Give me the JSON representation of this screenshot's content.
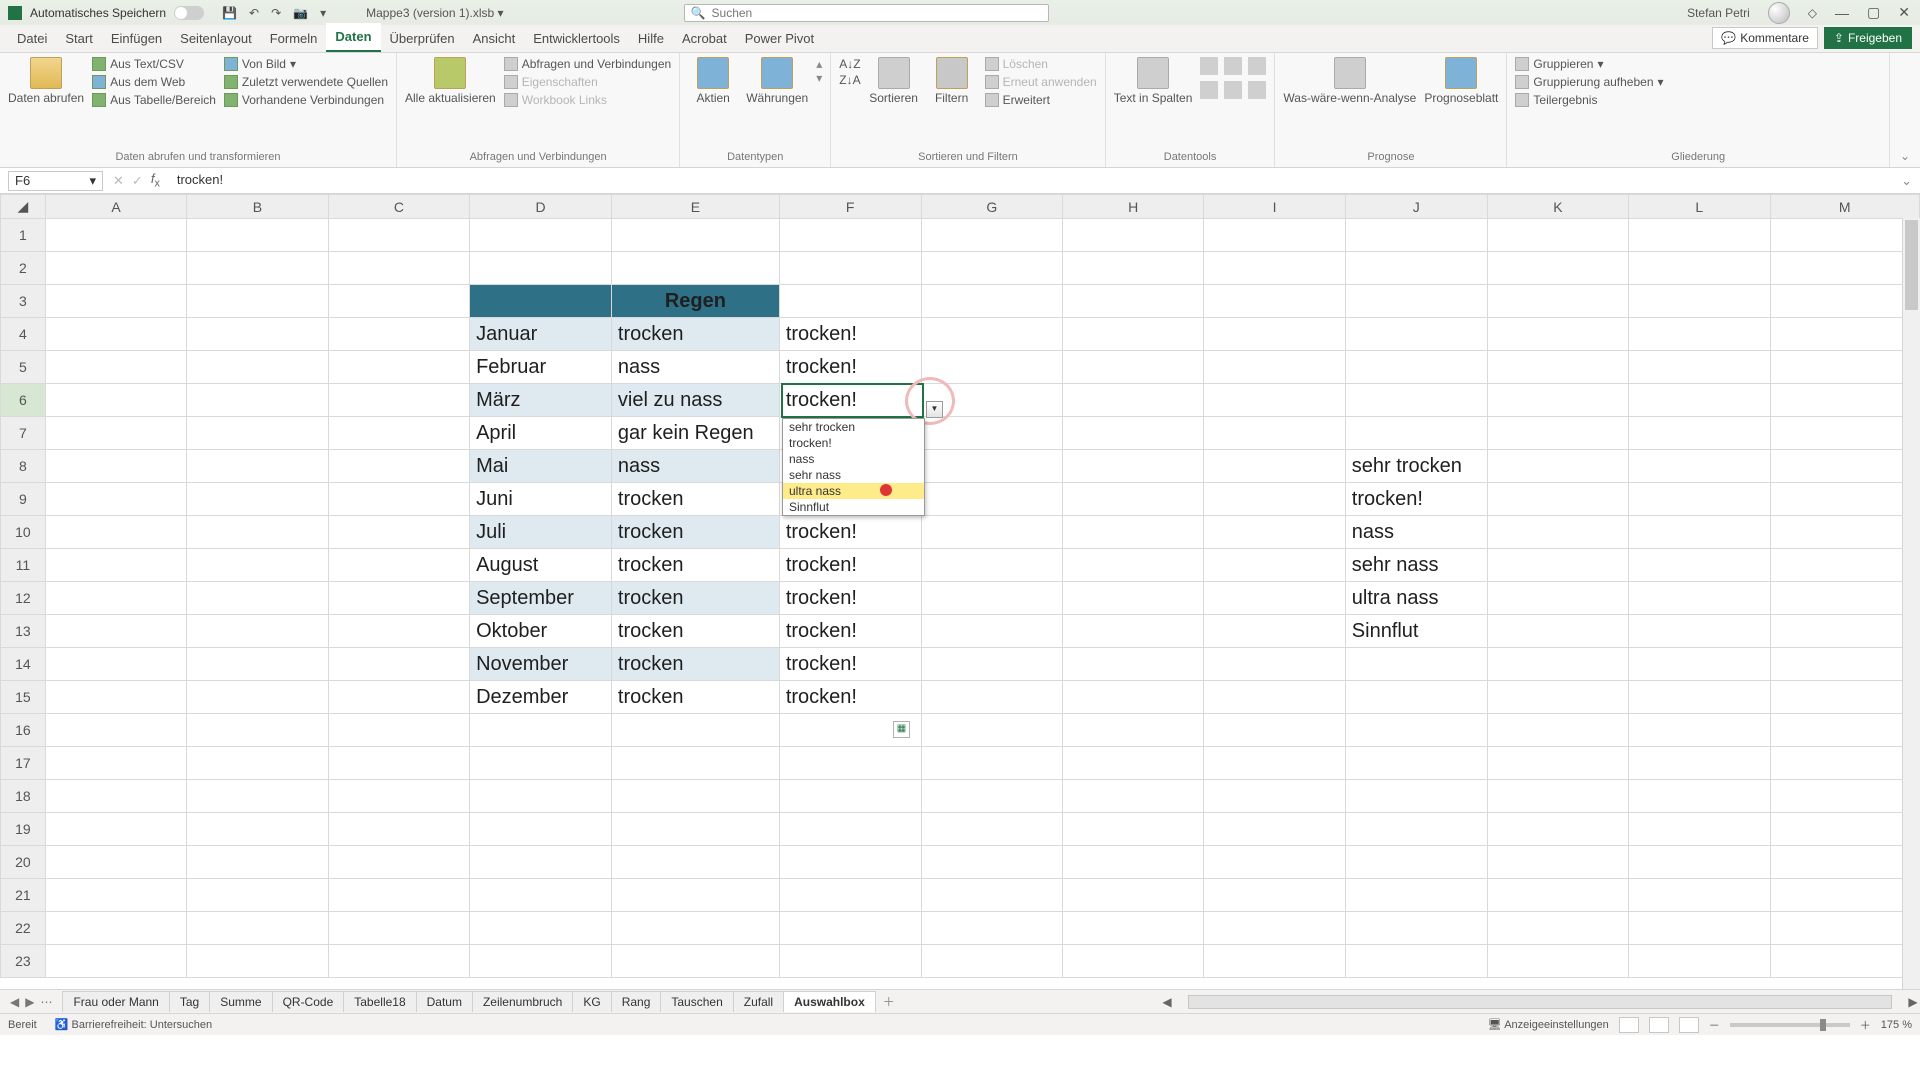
{
  "title": {
    "autosave": "Automatisches Speichern",
    "filename": "Mappe3 (version 1).xlsb",
    "search_placeholder": "Suchen",
    "user": "Stefan Petri"
  },
  "tabs": {
    "items": [
      "Datei",
      "Start",
      "Einfügen",
      "Seitenlayout",
      "Formeln",
      "Daten",
      "Überprüfen",
      "Ansicht",
      "Entwicklertools",
      "Hilfe",
      "Acrobat",
      "Power Pivot"
    ],
    "active": "Daten",
    "comments": "Kommentare",
    "share": "Freigeben"
  },
  "ribbon": {
    "g1": {
      "big": "Daten abrufen",
      "items": [
        "Aus Text/CSV",
        "Von Bild",
        "Aus dem Web",
        "Zuletzt verwendete Quellen",
        "Aus Tabelle/Bereich",
        "Vorhandene Verbindungen"
      ],
      "label": "Daten abrufen und transformieren"
    },
    "g2": {
      "big": "Alle aktualisieren",
      "items": [
        "Abfragen und Verbindungen",
        "Eigenschaften",
        "Workbook Links"
      ],
      "label": "Abfragen und Verbindungen"
    },
    "g3": {
      "a": "Aktien",
      "b": "Währungen",
      "label": "Datentypen"
    },
    "g4": {
      "sort": "Sortieren",
      "filter": "Filtern",
      "items": [
        "Löschen",
        "Erneut anwenden",
        "Erweitert"
      ],
      "label": "Sortieren und Filtern"
    },
    "g5": {
      "text": "Text in Spalten",
      "label": "Datentools"
    },
    "g6": {
      "a": "Was-wäre-wenn-Analyse",
      "b": "Prognoseblatt",
      "label": "Prognose"
    },
    "g7": {
      "items": [
        "Gruppieren",
        "Gruppierung aufheben",
        "Teilergebnis"
      ],
      "label": "Gliederung"
    }
  },
  "namebox": "F6",
  "formula": "trocken!",
  "columns": [
    "A",
    "B",
    "C",
    "D",
    "E",
    "F",
    "G",
    "H",
    "I",
    "J",
    "K",
    "L",
    "M"
  ],
  "rows": [
    1,
    2,
    3,
    4,
    5,
    6,
    7,
    8,
    9,
    10,
    11,
    12,
    13,
    14,
    15,
    16,
    17,
    18,
    19,
    20,
    21,
    22,
    23
  ],
  "active_row": 6,
  "table": {
    "header": {
      "D": "",
      "E": "Regen"
    },
    "data": [
      [
        "Januar",
        "trocken"
      ],
      [
        "Februar",
        "nass"
      ],
      [
        "März",
        "viel zu nass"
      ],
      [
        "April",
        "gar kein Regen"
      ],
      [
        "Mai",
        "nass"
      ],
      [
        "Juni",
        "trocken"
      ],
      [
        "Juli",
        "trocken"
      ],
      [
        "August",
        "trocken"
      ],
      [
        "September",
        "trocken"
      ],
      [
        "Oktober",
        "trocken"
      ],
      [
        "November",
        "trocken"
      ],
      [
        "Dezember",
        "trocken"
      ]
    ]
  },
  "colF": [
    "trocken!",
    "trocken!",
    "trocken!",
    "",
    "",
    "",
    "trocken!",
    "trocken!",
    "trocken!",
    "trocken!",
    "trocken!",
    "trocken!"
  ],
  "colJ": [
    "sehr trocken",
    "trocken!",
    "nass",
    "sehr nass",
    "ultra nass",
    "Sinnflut"
  ],
  "dropdown": {
    "items": [
      "sehr trocken",
      "trocken!",
      "nass",
      "sehr nass",
      "ultra nass",
      "Sinnflut"
    ],
    "highlight": 4
  },
  "sheets": {
    "items": [
      "Frau oder Mann",
      "Tag",
      "Summe",
      "QR-Code",
      "Tabelle18",
      "Datum",
      "Zeilenumbruch",
      "KG",
      "Rang",
      "Tauschen",
      "Zufall",
      "Auswahlbox"
    ],
    "active": "Auswahlbox"
  },
  "status": {
    "ready": "Bereit",
    "acc": "Barrierefreiheit: Untersuchen",
    "disp": "Anzeigeeinstellungen",
    "zoom": "175 %"
  }
}
